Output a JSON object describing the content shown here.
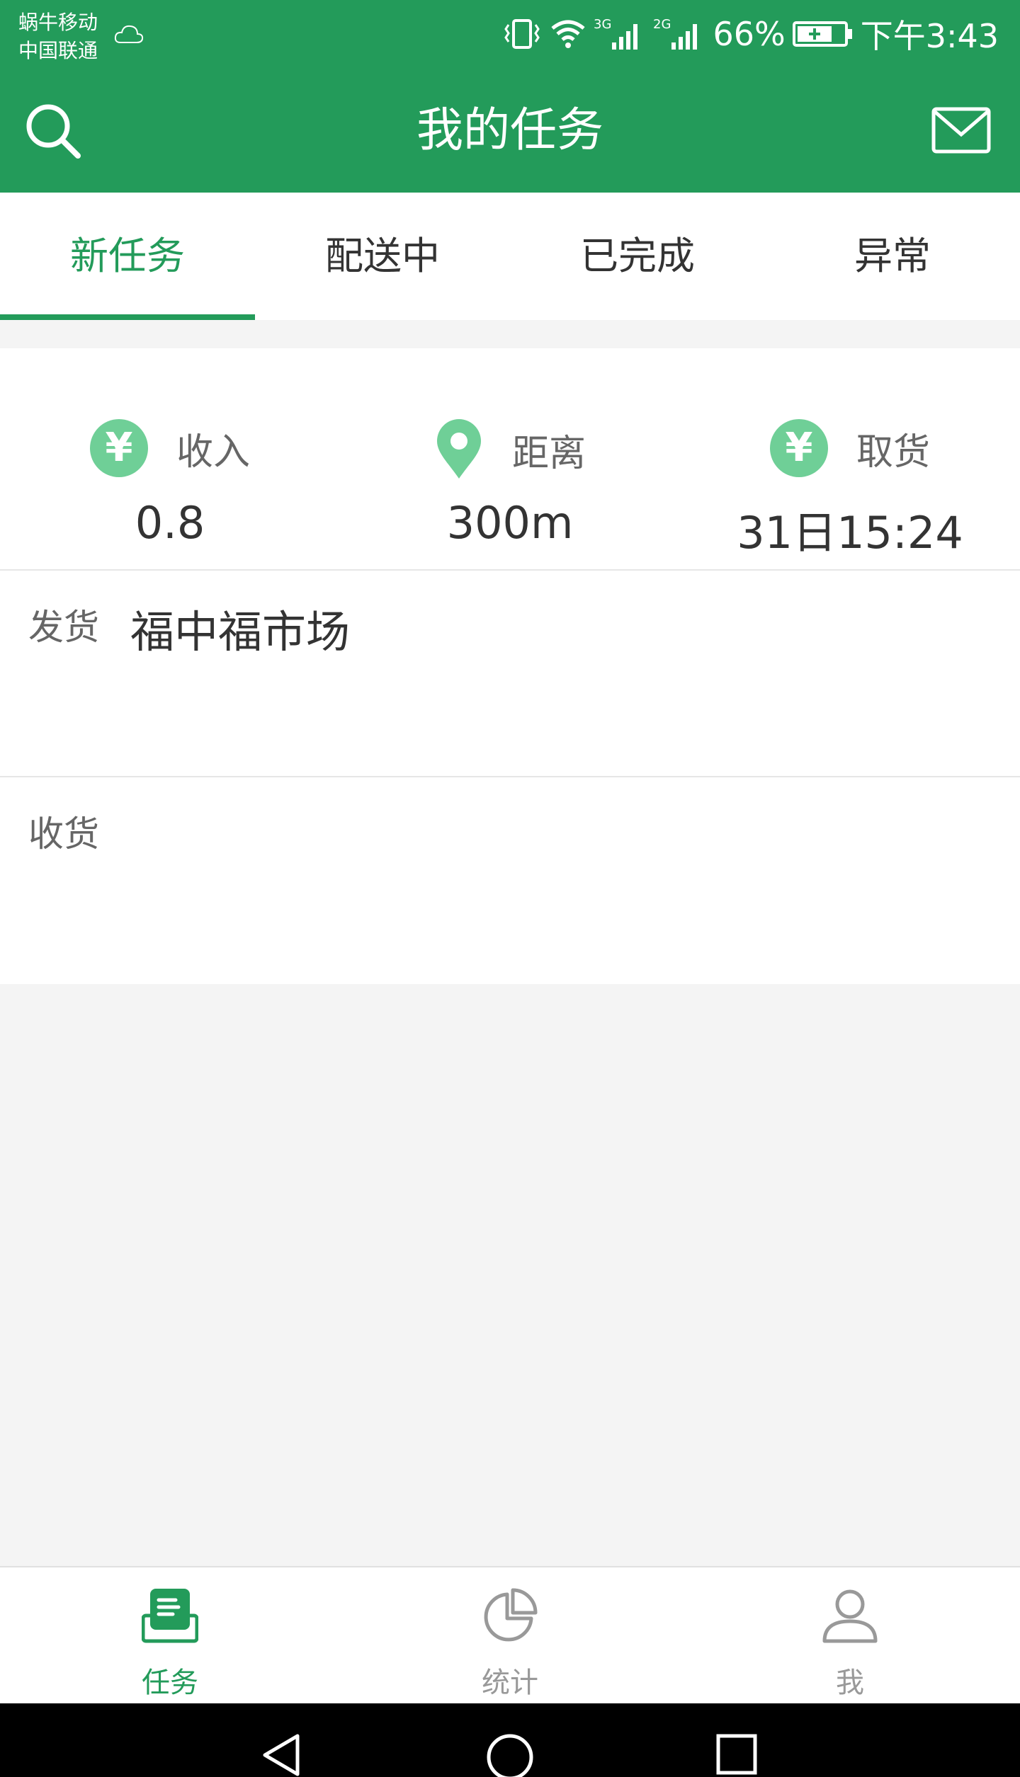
{
  "status_bar": {
    "carrier_line1": "蜗牛移动",
    "carrier_line2": "中国联通",
    "network1": "3G",
    "network2": "2G",
    "battery": "66%",
    "time": "下午3:43"
  },
  "header": {
    "title": "我的任务"
  },
  "tabs": [
    {
      "label": "新任务"
    },
    {
      "label": "配送中"
    },
    {
      "label": "已完成"
    },
    {
      "label": "异常"
    }
  ],
  "task": {
    "income_label": "收入",
    "income_value": "0.8",
    "income_symbol": "¥",
    "distance_label": "距离",
    "distance_value": "300m",
    "pickup_label": "取货",
    "pickup_symbol": "¥",
    "pickup_value": "31日15:24",
    "send_label": "发货",
    "send_value": "福中福市场",
    "receive_label": "收货",
    "receive_value": ""
  },
  "bottom_nav": [
    {
      "label": "任务",
      "icon": "task-icon"
    },
    {
      "label": "统计",
      "icon": "pie-chart-icon"
    },
    {
      "label": "我",
      "icon": "user-icon"
    }
  ],
  "colors": {
    "primary": "#239b5a",
    "accent_light": "#6fcf97",
    "background": "#f4f4f4"
  }
}
